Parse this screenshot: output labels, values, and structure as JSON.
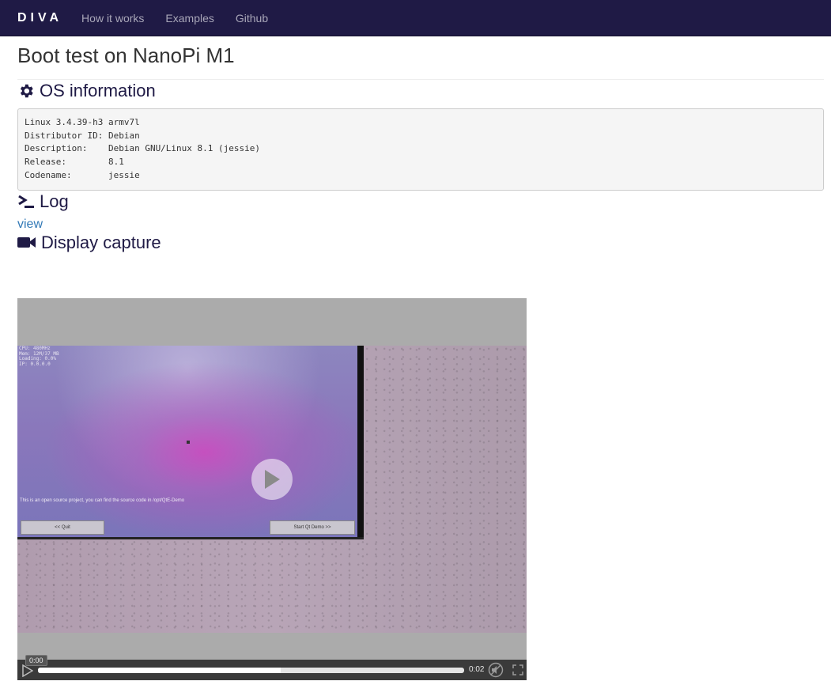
{
  "navbar": {
    "brand": "DIVA",
    "links": [
      "How it works",
      "Examples",
      "Github"
    ]
  },
  "page": {
    "title": "Boot test on NanoPi M1"
  },
  "os_section": {
    "heading": "OS information",
    "icon": "gear-icon",
    "lines": [
      "Linux 3.4.39-h3 armv7l",
      "Distributor ID: Debian",
      "Description:    Debian GNU/Linux 8.1 (jessie)",
      "Release:        8.1",
      "Codename:       jessie"
    ]
  },
  "log_section": {
    "heading": "Log",
    "icon": "terminal-icon",
    "link": "view"
  },
  "display_section": {
    "heading": "Display capture",
    "icon": "video-camera-icon"
  },
  "capture": {
    "status_lines": [
      "CPU: 480MHz",
      "Mem: 12M/37 MB",
      "Loading: 0.0%",
      "IP: 0.0.0.0"
    ],
    "message": "This is an open source project, you can find the source code in /opt/QtE-Demo",
    "quit_button": "<< Quit",
    "start_button": "Start Qt Demo >>"
  },
  "player": {
    "current_time": "0:00",
    "duration": "0:02",
    "progress": 0.57
  }
}
